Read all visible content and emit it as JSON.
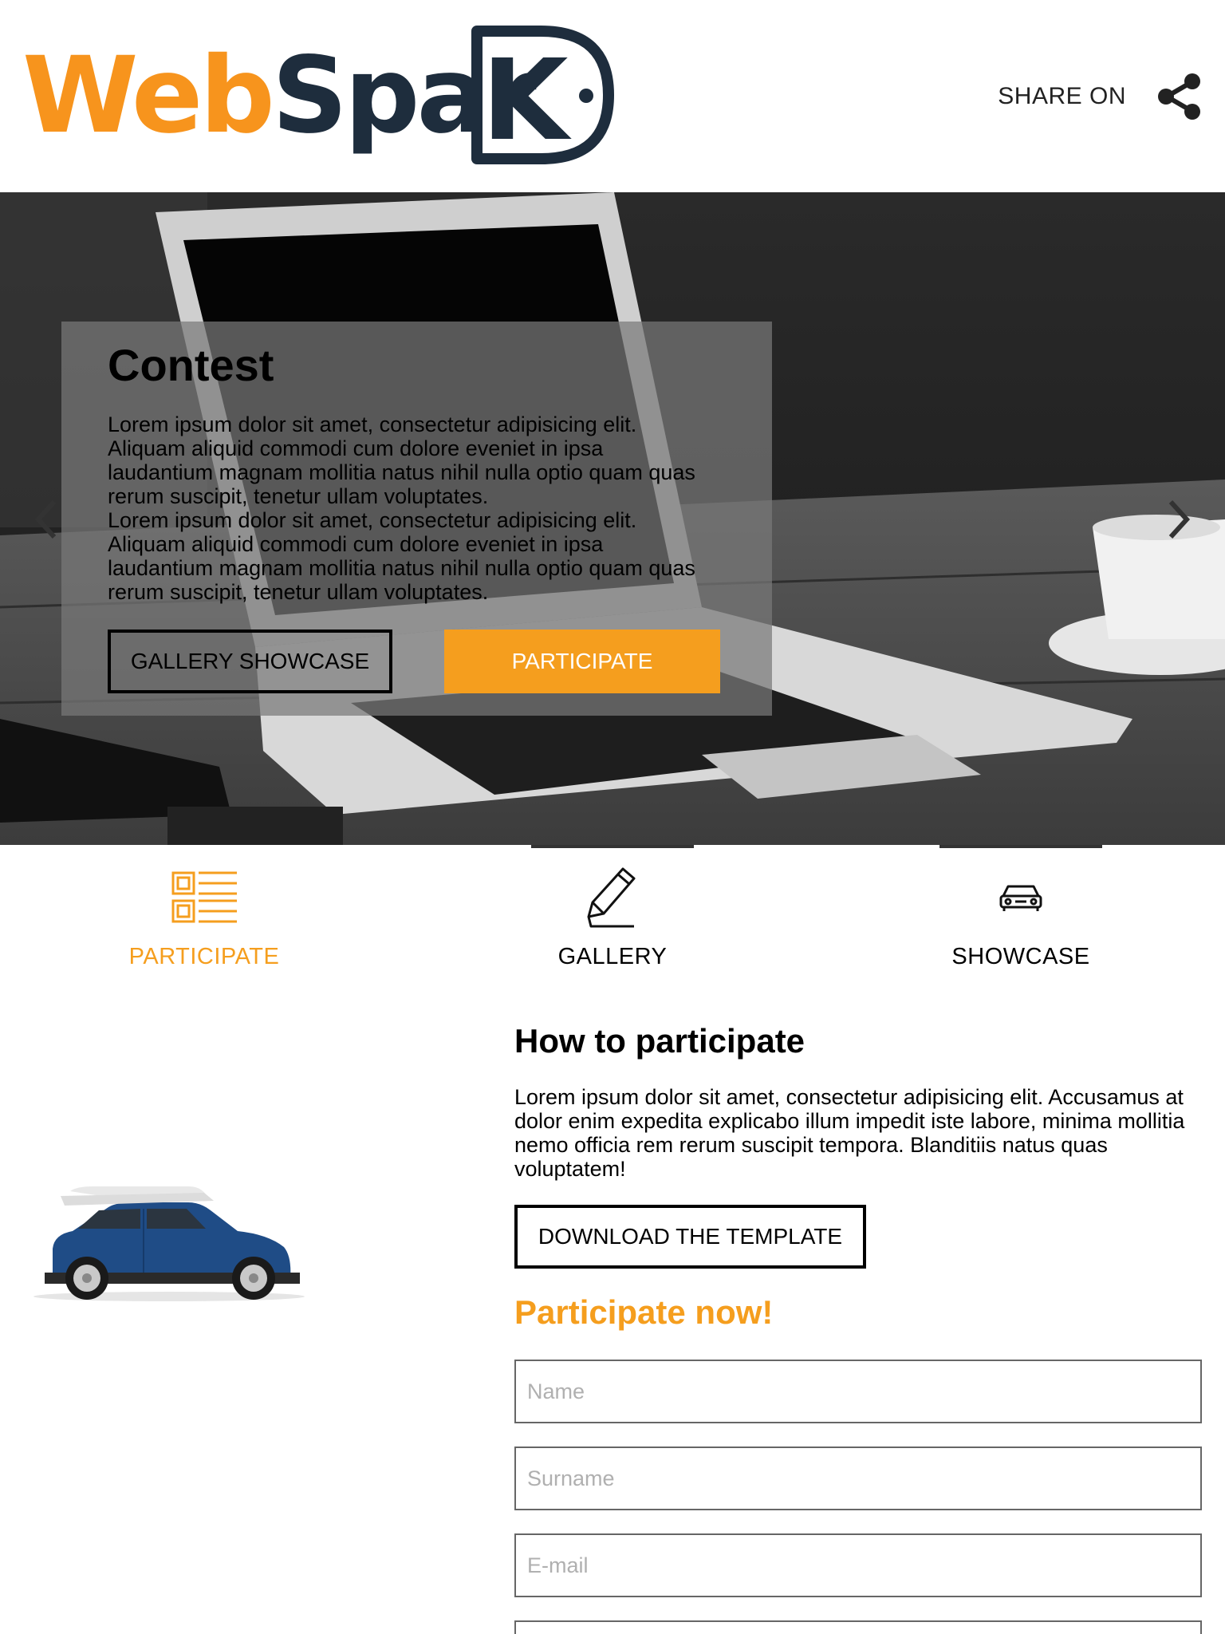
{
  "header": {
    "logo_web": "Web",
    "logo_spark": "Spar",
    "logo_k": "K",
    "share_label": "SHARE ON",
    "share_icon": "share-icon"
  },
  "hero": {
    "title": "Contest",
    "body_1": "Lorem ipsum dolor sit amet, consectetur adipisicing elit. Aliquam aliquid commodi cum dolore eveniet in ipsa laudantium magnam mollitia natus nihil nulla optio quam quas rerum suscipit, tenetur ullam voluptates.",
    "body_2": "Lorem ipsum dolor sit amet, consectetur adipisicing elit. Aliquam aliquid commodi cum dolore eveniet in ipsa laudantium magnam mollitia natus nihil nulla optio quam quas rerum suscipit, tenetur ullam voluptates.",
    "gallery_button": "GALLERY SHOWCASE",
    "participate_button": "PARTICIPATE",
    "prev_icon": "chevron-left-icon",
    "next_icon": "chevron-right-icon"
  },
  "tabs": [
    {
      "label": "PARTICIPATE",
      "icon": "list-icon",
      "active": true
    },
    {
      "label": "GALLERY",
      "icon": "pencil-icon",
      "active": false
    },
    {
      "label": "SHOWCASE",
      "icon": "car-icon",
      "active": false
    }
  ],
  "main": {
    "heading": "How to participate",
    "paragraph": "Lorem ipsum dolor sit amet, consectetur adipisicing elit. Accusamus at dolor enim expedita explicabo illum impedit iste labore, minima mollitia nemo officia rem rerum suscipit tempora. Blanditiis natus quas voluptatem!",
    "download_button": "DOWNLOAD THE TEMPLATE",
    "cta_heading": "Participate now!",
    "fields": {
      "name_placeholder": "Name",
      "surname_placeholder": "Surname",
      "email_placeholder": "E-mail"
    }
  },
  "colors": {
    "accent": "#f59e1e",
    "logo_dark": "#1e2d3d",
    "text": "#000000"
  }
}
